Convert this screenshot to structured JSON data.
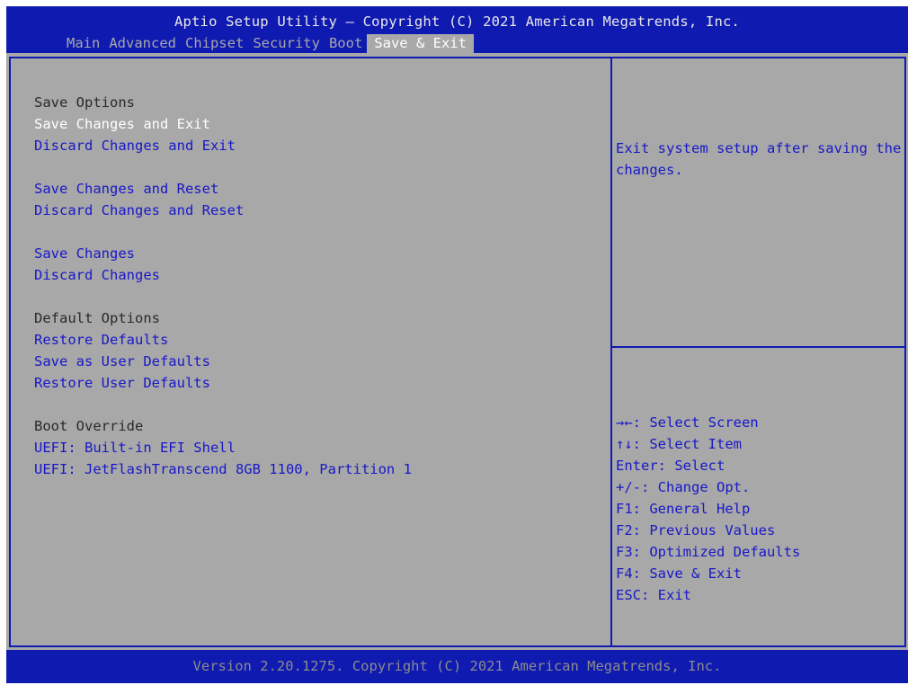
{
  "header": {
    "title": "Aptio Setup Utility – Copyright (C) 2021 American Megatrends, Inc.",
    "tabs": [
      "Main",
      "Advanced",
      "Chipset",
      "Security",
      "Boot",
      "Save & Exit"
    ],
    "active_tab": "Save & Exit"
  },
  "left": {
    "save_options_header": "Save Options",
    "save_changes_and_exit": "Save Changes and Exit",
    "discard_changes_and_exit": "Discard Changes and Exit",
    "save_changes_and_reset": "Save Changes and Reset",
    "discard_changes_and_reset": "Discard Changes and Reset",
    "save_changes": "Save Changes",
    "discard_changes": "Discard Changes",
    "default_options_header": "Default Options",
    "restore_defaults": "Restore Defaults",
    "save_as_user_defaults": "Save as User Defaults",
    "restore_user_defaults": "Restore User Defaults",
    "boot_override_header": "Boot Override",
    "uefi_efi_shell": "UEFI: Built-in EFI Shell",
    "uefi_jetflash": "UEFI: JetFlashTranscend 8GB 1100, Partition 1"
  },
  "right": {
    "help": "Exit system setup after saving the changes.",
    "keys": [
      "→←: Select Screen",
      "↑↓: Select Item",
      "Enter: Select",
      "+/-: Change Opt.",
      "F1: General Help",
      "F2: Previous Values",
      "F3: Optimized Defaults",
      "F4: Save & Exit",
      "ESC: Exit"
    ]
  },
  "footer": {
    "text": "Version 2.20.1275. Copyright (C) 2021 American Megatrends, Inc."
  },
  "colors": {
    "bios_blue": "#0f1ab0",
    "panel_gray": "#a8a8a8",
    "option_blue": "#1818c8",
    "highlight_white": "#ffffff"
  }
}
